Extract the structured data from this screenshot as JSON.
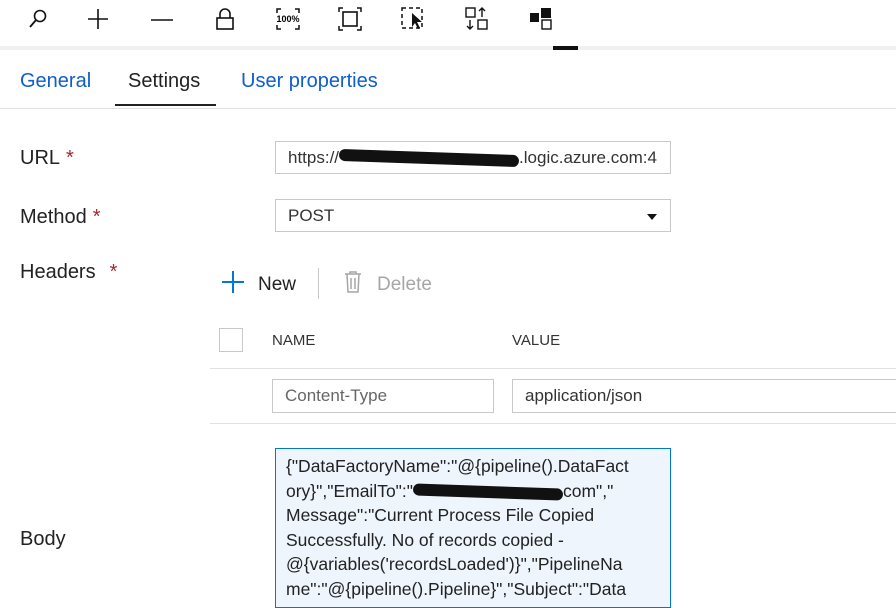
{
  "toolbar": {
    "items": [
      {
        "name": "search-icon",
        "label": "Search"
      },
      {
        "name": "zoom-in-icon",
        "label": "Zoom in"
      },
      {
        "name": "zoom-out-icon",
        "label": "Zoom out"
      },
      {
        "name": "lock-icon",
        "label": "Lock"
      },
      {
        "name": "zoom-100-icon",
        "label": "100%"
      },
      {
        "name": "fit-to-window-icon",
        "label": "Fit"
      },
      {
        "name": "select-icon",
        "label": "Select"
      },
      {
        "name": "auto-align-icon",
        "label": "Auto align"
      },
      {
        "name": "layout-icon",
        "label": "Layout"
      }
    ]
  },
  "tabs": [
    {
      "label": "General"
    },
    {
      "label": "Settings",
      "active": true
    },
    {
      "label": "User properties"
    }
  ],
  "form": {
    "url_label": "URL",
    "url_value_prefix": "https://",
    "url_value_suffix": ".logic.azure.com:4",
    "method_label": "Method",
    "method_value": "POST",
    "headers_label": "Headers",
    "new_label": "New",
    "delete_label": "Delete",
    "col_name": "NAME",
    "col_value": "VALUE",
    "header_rows": [
      {
        "name": "Content-Type",
        "value": "application/json"
      }
    ],
    "body_label": "Body",
    "required_mark": "*",
    "body_lines": [
      "{\"DataFactoryName\":\"@{pipeline().DataFact",
      "ory}\",\"EmailTo\":\"",
      "com\",\"",
      "Message\":\"Current Process File Copied",
      "Successfully. No of records copied -",
      "@{variables('recordsLoaded')}\",\"PipelineNa",
      "me\":\"@{pipeline().Pipeline}\",\"Subject\":\"Data"
    ]
  },
  "colors": {
    "accent": "#0078d4",
    "required": "#a4262c",
    "tab_text": "#0f5ec9"
  }
}
